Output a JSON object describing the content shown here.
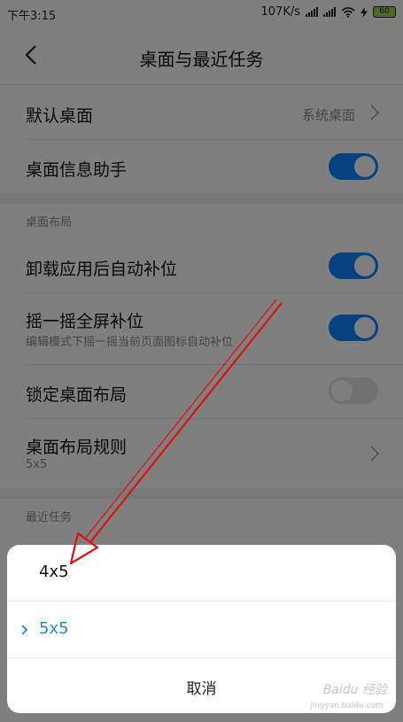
{
  "status_bar": {
    "time": "下午3:15",
    "net_speed": "107K/s",
    "battery": "60"
  },
  "header": {
    "title": "桌面与最近任务"
  },
  "settings": {
    "default_desktop": {
      "label": "默认桌面",
      "value": "系统桌面"
    },
    "info_assistant": {
      "label": "桌面信息助手",
      "enabled": true
    },
    "layout_section": "桌面布局",
    "auto_fill": {
      "label": "卸载应用后自动补位",
      "enabled": true
    },
    "shake_fill": {
      "label": "摇一摇全屏补位",
      "sub": "编辑模式下摇一摇当前页面图标自动补位",
      "enabled": true
    },
    "lock_layout": {
      "label": "锁定桌面布局",
      "enabled": false
    },
    "layout_rule": {
      "label": "桌面布局规则",
      "sub": "5x5"
    },
    "recent_section": "最近任务"
  },
  "sheet": {
    "options": [
      {
        "label": "4x5",
        "selected": false
      },
      {
        "label": "5x5",
        "selected": true
      }
    ],
    "cancel_label": "取消",
    "accent_color": "#1a8fd6"
  },
  "watermark": {
    "brand": "Baidu 经验",
    "url": "jingyan.baidu.com"
  }
}
